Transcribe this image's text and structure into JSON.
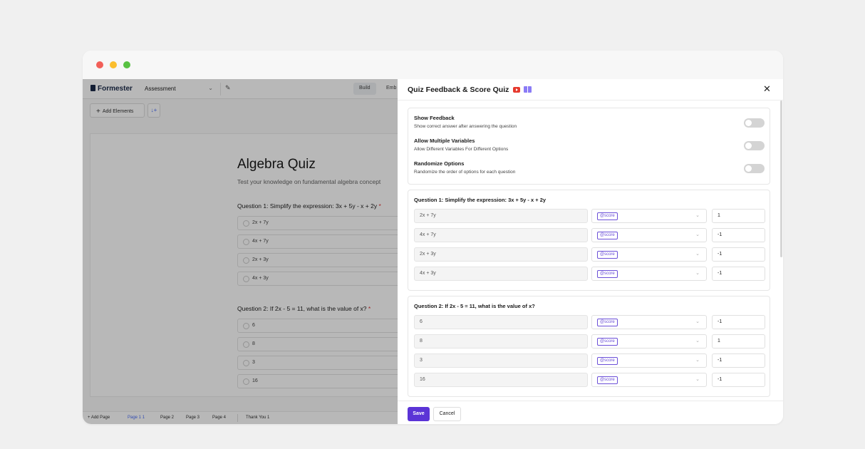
{
  "app": {
    "logo": "Formester",
    "form_name": "Assessment",
    "modes": [
      "Build",
      "Emb"
    ],
    "add_elements": "Add Elements"
  },
  "canvas": {
    "title": "Algebra Quiz",
    "subtitle": "Test your knowledge on fundamental algebra concept",
    "questions": [
      {
        "label": "Question 1: Simplify the expression: 3x + 5y - x + 2y",
        "options": [
          "2x + 7y",
          "4x + 7y",
          "2x + 3y",
          "4x + 3y"
        ]
      },
      {
        "label": "Question 2: If 2x - 5 = 11, what is the value of x?",
        "options": [
          "6",
          "8",
          "3",
          "16"
        ]
      }
    ]
  },
  "pages_bar": {
    "add_page": "Add Page",
    "pages": [
      "Page 1",
      "Page 2",
      "Page 3",
      "Page 4"
    ],
    "active_index": "1",
    "thank_you": "Thank You 1"
  },
  "drawer": {
    "title": "Quiz Feedback & Score Quiz",
    "settings": [
      {
        "title": "Show Feedback",
        "desc": "Show correct answer after answering the question",
        "enabled": false
      },
      {
        "title": "Allow Multiple Variables",
        "desc": "Allow Different Variables For Different Options",
        "enabled": false
      },
      {
        "title": "Randomize Options",
        "desc": "Randomize the order of options for each question",
        "enabled": false
      }
    ],
    "questions": [
      {
        "title": "Question 1: Simplify the expression: 3x + 5y - x + 2y",
        "rows": [
          {
            "option": "2x + 7y",
            "variable": "@score",
            "score": "1"
          },
          {
            "option": "4x + 7y",
            "variable": "@score",
            "score": "-1"
          },
          {
            "option": "2x + 3y",
            "variable": "@score",
            "score": "-1"
          },
          {
            "option": "4x + 3y",
            "variable": "@score",
            "score": "-1"
          }
        ]
      },
      {
        "title": "Question 2: If 2x - 5 = 11, what is the value of x?",
        "rows": [
          {
            "option": "6",
            "variable": "@score",
            "score": "-1"
          },
          {
            "option": "8",
            "variable": "@score",
            "score": "1"
          },
          {
            "option": "3",
            "variable": "@score",
            "score": "-1"
          },
          {
            "option": "16",
            "variable": "@score",
            "score": "-1"
          }
        ]
      }
    ],
    "save": "Save",
    "cancel": "Cancel"
  },
  "colors": {
    "accent": "#5b34d6",
    "variable_tag": "#6b4fd8",
    "youtube": "#e63a2e",
    "book": "#8b7cf6"
  }
}
